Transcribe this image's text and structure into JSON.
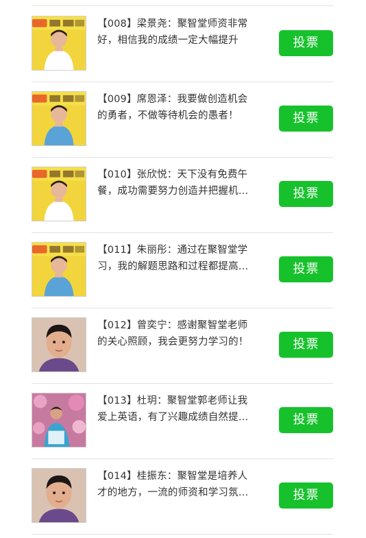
{
  "accent_color": "#17c12c",
  "vote_label": "投票",
  "candidates": [
    {
      "line1": "【008】梁景尧：聚智堂师资非常",
      "line2": "好，相信我的成绩一定大幅提升",
      "photo": "student-photo-yellow-banner"
    },
    {
      "line1": "【009】席恩泽：我要做创造机会",
      "line2": "的勇者，不做等待机会的愚者！",
      "photo": "student-photo-yellow-banner"
    },
    {
      "line1": "【010】张欣悦：天下没有免费午",
      "line2": "餐，成功需要努力创造并把握机…",
      "photo": "student-photo-yellow-banner"
    },
    {
      "line1": "【011】朱丽彤：通过在聚智堂学",
      "line2": "习，我的解题思路和过程都提高…",
      "photo": "student-photo-yellow-banner"
    },
    {
      "line1": "【012】曾奕宁：感谢聚智堂老师",
      "line2": "的关心照顾，我会更努力学习的！",
      "photo": "student-portrait"
    },
    {
      "line1": "【013】杜玥：聚智堂郭老师让我",
      "line2": "爱上英语，有了兴趣成绩自然提…",
      "photo": "student-photo-blossoms"
    },
    {
      "line1": "【014】桂振东：聚智堂是培养人",
      "line2": "才的地方，一流的师资和学习氛…",
      "photo": "student-portrait"
    }
  ]
}
